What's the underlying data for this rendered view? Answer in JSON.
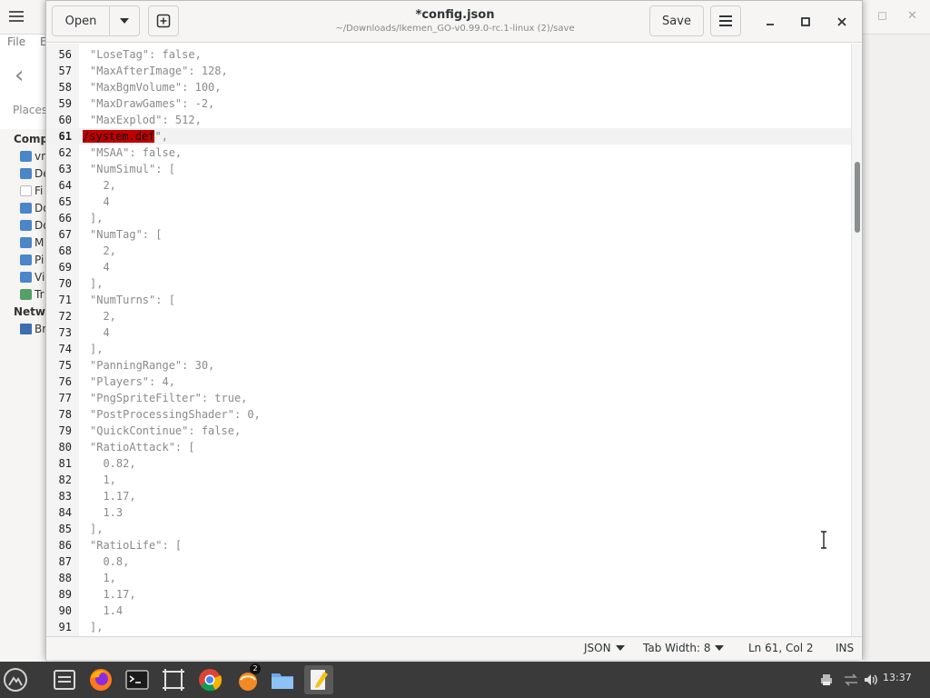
{
  "background_window": {
    "menu": [
      "File",
      "E"
    ],
    "places_label": "Places",
    "computer_label": "Comp",
    "network_label": "Netwo",
    "sidebar_items": [
      {
        "label": "vn",
        "icon": "home-folder-icon"
      },
      {
        "label": "De",
        "icon": "desktop-folder-icon"
      },
      {
        "label": "Fi",
        "icon": "file-system-icon"
      },
      {
        "label": "Do",
        "icon": "documents-folder-icon"
      },
      {
        "label": "Do",
        "icon": "downloads-folder-icon"
      },
      {
        "label": "M",
        "icon": "music-folder-icon"
      },
      {
        "label": "Pi",
        "icon": "pictures-folder-icon"
      },
      {
        "label": "Vi",
        "icon": "videos-folder-icon"
      },
      {
        "label": "Tr",
        "icon": "trash-icon"
      }
    ],
    "network_items": [
      {
        "label": "Br",
        "icon": "browse-network-icon"
      }
    ]
  },
  "editor": {
    "open_label": "Open",
    "save_label": "Save",
    "title": "*config.json",
    "subtitle": "~/Downloads/Ikemen_GO-v0.99.0-rc.1-linux (2)/save",
    "lines": [
      {
        "n": "56",
        "text": "\"LoseTag\": false,"
      },
      {
        "n": "57",
        "text": "\"MaxAfterImage\": 128,"
      },
      {
        "n": "58",
        "text": "\"MaxBgmVolume\": 100,"
      },
      {
        "n": "59",
        "text": "\"MaxDrawGames\": -2,"
      },
      {
        "n": "60",
        "text": "\"MaxExplod\": 512,"
      },
      {
        "n": "61",
        "text": "\",",
        "selected": "/system.def"
      },
      {
        "n": "62",
        "text": "\"MSAA\": false,"
      },
      {
        "n": "63",
        "text": "\"NumSimul\": ["
      },
      {
        "n": "64",
        "text": "  2,"
      },
      {
        "n": "65",
        "text": "  4"
      },
      {
        "n": "66",
        "text": "],"
      },
      {
        "n": "67",
        "text": "\"NumTag\": ["
      },
      {
        "n": "68",
        "text": "  2,"
      },
      {
        "n": "69",
        "text": "  4"
      },
      {
        "n": "70",
        "text": "],"
      },
      {
        "n": "71",
        "text": "\"NumTurns\": ["
      },
      {
        "n": "72",
        "text": "  2,"
      },
      {
        "n": "73",
        "text": "  4"
      },
      {
        "n": "74",
        "text": "],"
      },
      {
        "n": "75",
        "text": "\"PanningRange\": 30,"
      },
      {
        "n": "76",
        "text": "\"Players\": 4,"
      },
      {
        "n": "77",
        "text": "\"PngSpriteFilter\": true,"
      },
      {
        "n": "78",
        "text": "\"PostProcessingShader\": 0,"
      },
      {
        "n": "79",
        "text": "\"QuickContinue\": false,"
      },
      {
        "n": "80",
        "text": "\"RatioAttack\": ["
      },
      {
        "n": "81",
        "text": "  0.82,"
      },
      {
        "n": "82",
        "text": "  1,"
      },
      {
        "n": "83",
        "text": "  1.17,"
      },
      {
        "n": "84",
        "text": "  1.3"
      },
      {
        "n": "85",
        "text": "],"
      },
      {
        "n": "86",
        "text": "\"RatioLife\": ["
      },
      {
        "n": "87",
        "text": "  0.8,"
      },
      {
        "n": "88",
        "text": "  1,"
      },
      {
        "n": "89",
        "text": "  1.17,"
      },
      {
        "n": "90",
        "text": "  1.4"
      },
      {
        "n": "91",
        "text": "],"
      }
    ],
    "current_line": "61",
    "status": {
      "language": "JSON",
      "tab_width": "Tab Width: 8",
      "cursor": "Ln 61, Col 2",
      "mode": "INS"
    }
  },
  "taskbar": {
    "clock": "13:37",
    "badge_count": "2",
    "apps": [
      "menu-icon",
      "files-icon",
      "firefox-icon",
      "terminal-icon",
      "screenshot-icon",
      "chrome-icon",
      "app-icon",
      "folder-icon",
      "text-editor-icon"
    ]
  },
  "colors": {
    "selection": "#c00000",
    "code_text": "#8a8a8a",
    "taskbar": "#3a3a3a",
    "header": "#f6f5f4"
  }
}
